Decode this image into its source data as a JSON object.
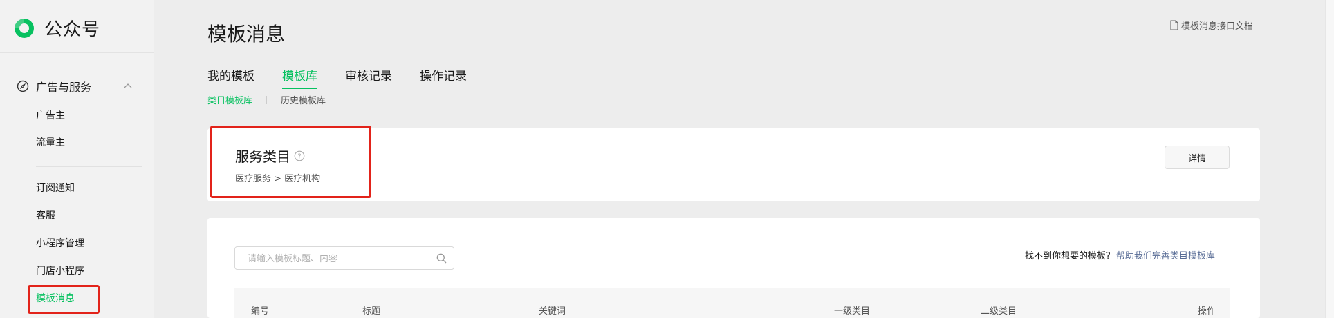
{
  "app": {
    "name": "公众号",
    "brand_color": "#07c160",
    "highlight_color": "#e2231a"
  },
  "sidebar": {
    "group": {
      "label": "广告与服务",
      "icon": "compass-icon",
      "expanded": true
    },
    "items": [
      {
        "label": "广告主"
      },
      {
        "label": "流量主"
      },
      {
        "label": "订阅通知"
      },
      {
        "label": "客服"
      },
      {
        "label": "小程序管理"
      },
      {
        "label": "门店小程序"
      },
      {
        "label": "模板消息",
        "active": true
      }
    ]
  },
  "header": {
    "title": "模板消息",
    "doc_link": "模板消息接口文档"
  },
  "tabs": [
    {
      "label": "我的模板"
    },
    {
      "label": "模板库",
      "active": true
    },
    {
      "label": "审核记录"
    },
    {
      "label": "操作记录"
    }
  ],
  "subtabs": [
    {
      "label": "类目模板库",
      "active": true
    },
    {
      "label": "历史模板库"
    }
  ],
  "category": {
    "title": "服务类目",
    "breadcrumb": "医疗服务 > 医疗机构",
    "detail_button": "详情"
  },
  "search": {
    "placeholder": "请输入模板标题、内容",
    "value": ""
  },
  "hint": {
    "text": "找不到你想要的模板?",
    "link": "帮助我们完善类目模板库"
  },
  "table": {
    "columns": [
      "编号",
      "标题",
      "关键词",
      "一级类目",
      "二级类目",
      "操作"
    ]
  }
}
